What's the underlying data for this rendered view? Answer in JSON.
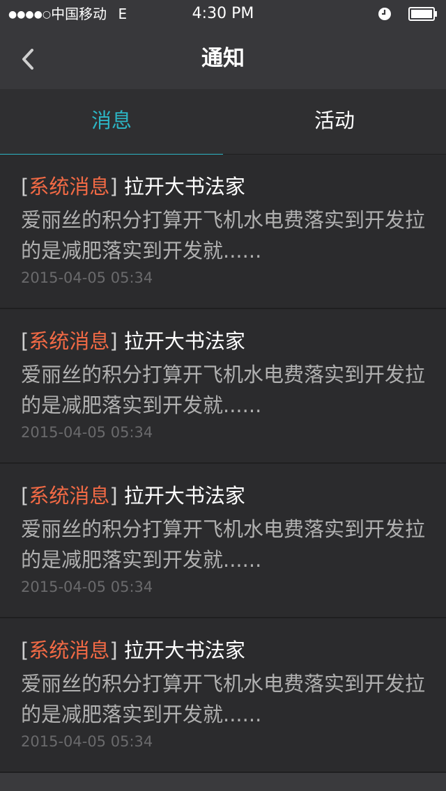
{
  "status_bar": {
    "signal": "●●●●○",
    "carrier": "中国移动",
    "network": "E",
    "time": "4:30 PM"
  },
  "nav": {
    "title": "通知"
  },
  "tabs": [
    {
      "label": "消息",
      "active": true
    },
    {
      "label": "活动",
      "active": false
    }
  ],
  "messages": [
    {
      "bracket_open": "[",
      "tag": "系统消息",
      "bracket_close": "]",
      "title": " 拉开大书法家",
      "body": "爱丽丝的积分打算开飞机水电费落实到开发拉的是减肥落实到开发就......",
      "time": "2015-04-05 05:34"
    },
    {
      "bracket_open": "[",
      "tag": "系统消息",
      "bracket_close": "]",
      "title": " 拉开大书法家",
      "body": "爱丽丝的积分打算开飞机水电费落实到开发拉的是减肥落实到开发就......",
      "time": "2015-04-05 05:34"
    },
    {
      "bracket_open": "[",
      "tag": "系统消息",
      "bracket_close": "]",
      "title": " 拉开大书法家",
      "body": "爱丽丝的积分打算开飞机水电费落实到开发拉的是减肥落实到开发就......",
      "time": "2015-04-05 05:34"
    },
    {
      "bracket_open": "[",
      "tag": "系统消息",
      "bracket_close": "]",
      "title": " 拉开大书法家",
      "body": "爱丽丝的积分打算开飞机水电费落实到开发拉的是减肥落实到开发就......",
      "time": "2015-04-05 05:34"
    }
  ],
  "colors": {
    "accent": "#2cb5c4",
    "tag": "#f26a45",
    "background": "#2b2b2d",
    "bar": "#38383b"
  },
  "icons": {
    "back": "chevron-left-icon",
    "clock": "clock-icon",
    "battery": "battery-icon"
  }
}
